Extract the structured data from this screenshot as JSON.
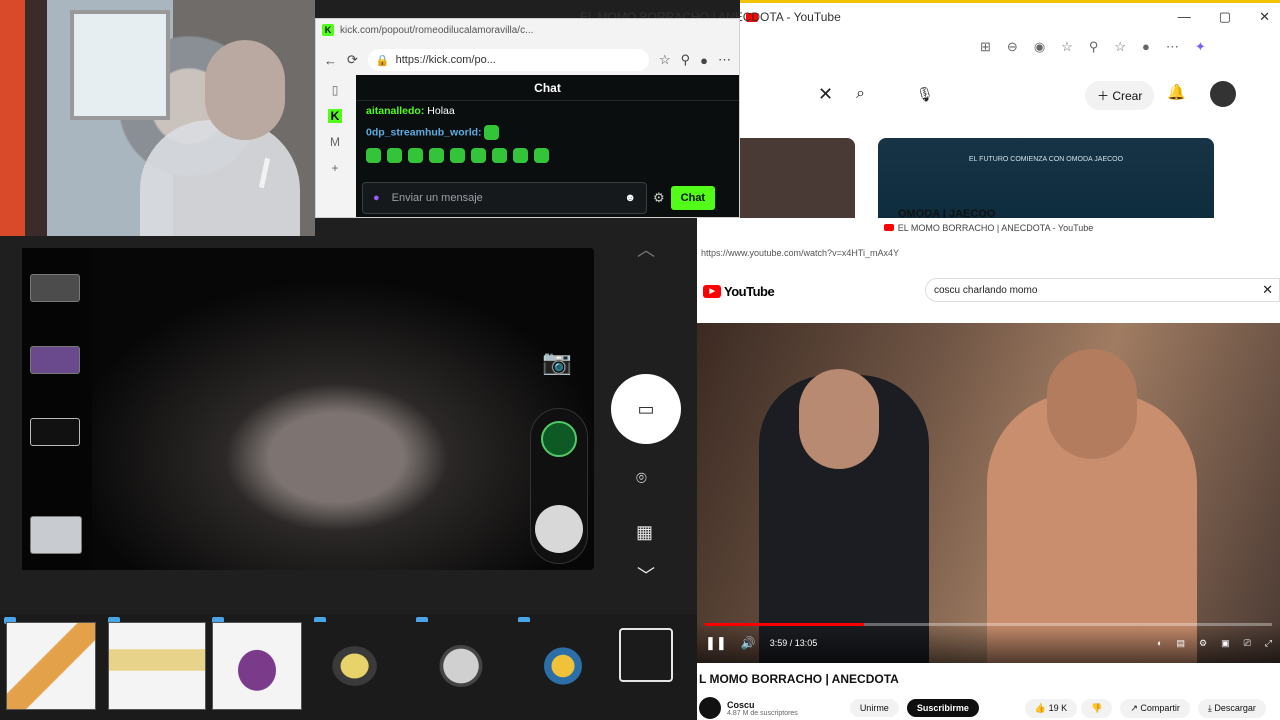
{
  "kick_popout": {
    "url_tab": "kick.com/popout/romeodilucalamoravilla/c...",
    "url": "https://kick.com/po...",
    "chat_title": "Chat",
    "messages": [
      {
        "user": "aitanalledo",
        "text": "Holaa"
      },
      {
        "user": "0dp_streamhub_world",
        "text": ""
      }
    ],
    "input_placeholder": "Enviar un mensaje",
    "send_label": "Chat"
  },
  "yt_back": {
    "tab_title": "EL MOMO BORRACHO | ANECDOTA - YouTube",
    "create_label": "Crear",
    "ad_text": "EL FUTURO COMIENZA CON OMODA JAECOO",
    "ad_channel": "OMODA | JAECOO"
  },
  "yt_pop": {
    "window_title": "EL MOMO BORRACHO | ANECDOTA - YouTube",
    "url": "https://www.youtube.com/watch?v=x4HTi_mAx4Y",
    "logo_text": "YouTube",
    "search_value": "coscu charlando momo",
    "time": "3:59 / 13:05",
    "video_title": "L MOMO BORRACHO | ANECDOTA",
    "channel_name": "Coscu",
    "subscribers": "4.87 M de suscriptores",
    "join_label": "Unirme",
    "subscribe_label": "Suscribirme",
    "likes": "19 K",
    "share_label": "Compartir",
    "download_label": "Descargar"
  },
  "colors": {
    "kick_green": "#53fc18",
    "youtube_red": "#ff0000"
  }
}
